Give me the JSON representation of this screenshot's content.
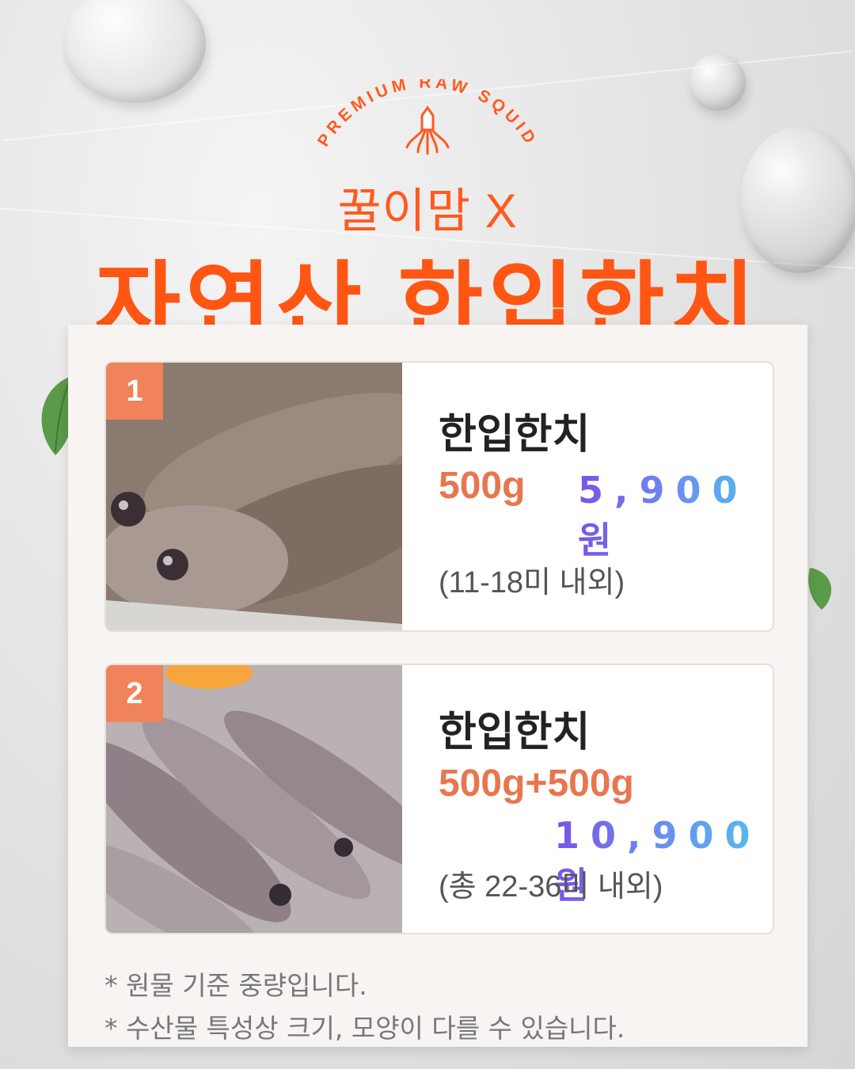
{
  "header": {
    "arc_text": "PREMIUM RAW SQUID",
    "brand_line": "꿀이맘 X",
    "title": "자연산 한입한치",
    "accent_color": "#ff5614",
    "logo_icon": "squid-icon"
  },
  "products": [
    {
      "badge": "1",
      "name": "한입한치",
      "weight": "500g",
      "price": "5,900원",
      "count": "(11-18미 내외)"
    },
    {
      "badge": "2",
      "name": "한입한치",
      "weight": "500g+500g",
      "price": "10,900원",
      "count": "(총 22-36미 내외)"
    }
  ],
  "notes": [
    "* 원물 기준 중량입니다.",
    "* 수산물 특성상 크기, 모양이 다를 수 있습니다."
  ]
}
